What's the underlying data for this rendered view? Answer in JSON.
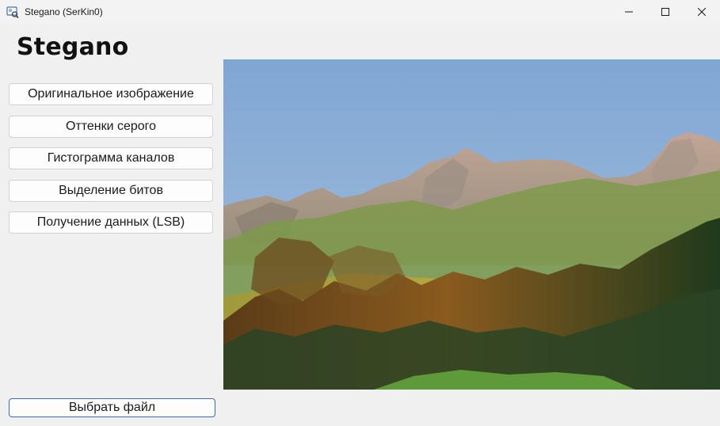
{
  "window": {
    "title": "Stegano (SerKin0)",
    "icon": "app-icon"
  },
  "titlebar_buttons": [
    "minimize-icon",
    "maximize-icon",
    "close-icon"
  ],
  "app": {
    "heading": "Stegano"
  },
  "sidebar": {
    "buttons": [
      {
        "label": "Оригинальное изображение"
      },
      {
        "label": "Оттенки серого"
      },
      {
        "label": "Гистограмма каналов"
      },
      {
        "label": "Выделение битов"
      },
      {
        "label": "Получение данных (LSB)"
      }
    ],
    "choose_file": "Выбрать файл"
  },
  "image_panel": {
    "content": "mountain-landscape-photo"
  },
  "colors": {
    "accent_border": "#3a6ea8",
    "sky": "#86acd6"
  }
}
